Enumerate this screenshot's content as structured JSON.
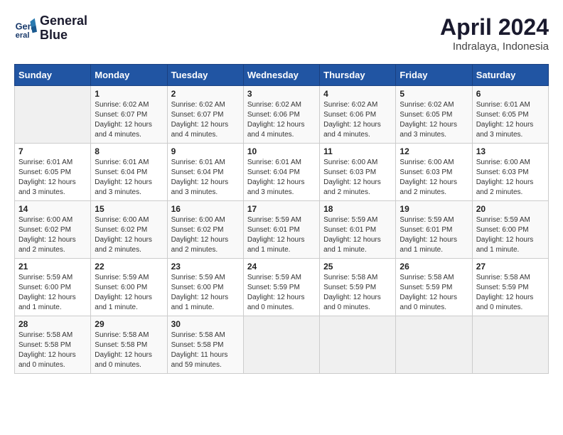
{
  "header": {
    "logo_line1": "General",
    "logo_line2": "Blue",
    "month": "April 2024",
    "location": "Indralaya, Indonesia"
  },
  "weekdays": [
    "Sunday",
    "Monday",
    "Tuesday",
    "Wednesday",
    "Thursday",
    "Friday",
    "Saturday"
  ],
  "weeks": [
    [
      {
        "day": "",
        "info": ""
      },
      {
        "day": "1",
        "info": "Sunrise: 6:02 AM\nSunset: 6:07 PM\nDaylight: 12 hours\nand 4 minutes."
      },
      {
        "day": "2",
        "info": "Sunrise: 6:02 AM\nSunset: 6:07 PM\nDaylight: 12 hours\nand 4 minutes."
      },
      {
        "day": "3",
        "info": "Sunrise: 6:02 AM\nSunset: 6:06 PM\nDaylight: 12 hours\nand 4 minutes."
      },
      {
        "day": "4",
        "info": "Sunrise: 6:02 AM\nSunset: 6:06 PM\nDaylight: 12 hours\nand 4 minutes."
      },
      {
        "day": "5",
        "info": "Sunrise: 6:02 AM\nSunset: 6:05 PM\nDaylight: 12 hours\nand 3 minutes."
      },
      {
        "day": "6",
        "info": "Sunrise: 6:01 AM\nSunset: 6:05 PM\nDaylight: 12 hours\nand 3 minutes."
      }
    ],
    [
      {
        "day": "7",
        "info": "Sunrise: 6:01 AM\nSunset: 6:05 PM\nDaylight: 12 hours\nand 3 minutes."
      },
      {
        "day": "8",
        "info": "Sunrise: 6:01 AM\nSunset: 6:04 PM\nDaylight: 12 hours\nand 3 minutes."
      },
      {
        "day": "9",
        "info": "Sunrise: 6:01 AM\nSunset: 6:04 PM\nDaylight: 12 hours\nand 3 minutes."
      },
      {
        "day": "10",
        "info": "Sunrise: 6:01 AM\nSunset: 6:04 PM\nDaylight: 12 hours\nand 3 minutes."
      },
      {
        "day": "11",
        "info": "Sunrise: 6:00 AM\nSunset: 6:03 PM\nDaylight: 12 hours\nand 2 minutes."
      },
      {
        "day": "12",
        "info": "Sunrise: 6:00 AM\nSunset: 6:03 PM\nDaylight: 12 hours\nand 2 minutes."
      },
      {
        "day": "13",
        "info": "Sunrise: 6:00 AM\nSunset: 6:03 PM\nDaylight: 12 hours\nand 2 minutes."
      }
    ],
    [
      {
        "day": "14",
        "info": "Sunrise: 6:00 AM\nSunset: 6:02 PM\nDaylight: 12 hours\nand 2 minutes."
      },
      {
        "day": "15",
        "info": "Sunrise: 6:00 AM\nSunset: 6:02 PM\nDaylight: 12 hours\nand 2 minutes."
      },
      {
        "day": "16",
        "info": "Sunrise: 6:00 AM\nSunset: 6:02 PM\nDaylight: 12 hours\nand 2 minutes."
      },
      {
        "day": "17",
        "info": "Sunrise: 5:59 AM\nSunset: 6:01 PM\nDaylight: 12 hours\nand 1 minute."
      },
      {
        "day": "18",
        "info": "Sunrise: 5:59 AM\nSunset: 6:01 PM\nDaylight: 12 hours\nand 1 minute."
      },
      {
        "day": "19",
        "info": "Sunrise: 5:59 AM\nSunset: 6:01 PM\nDaylight: 12 hours\nand 1 minute."
      },
      {
        "day": "20",
        "info": "Sunrise: 5:59 AM\nSunset: 6:00 PM\nDaylight: 12 hours\nand 1 minute."
      }
    ],
    [
      {
        "day": "21",
        "info": "Sunrise: 5:59 AM\nSunset: 6:00 PM\nDaylight: 12 hours\nand 1 minute."
      },
      {
        "day": "22",
        "info": "Sunrise: 5:59 AM\nSunset: 6:00 PM\nDaylight: 12 hours\nand 1 minute."
      },
      {
        "day": "23",
        "info": "Sunrise: 5:59 AM\nSunset: 6:00 PM\nDaylight: 12 hours\nand 1 minute."
      },
      {
        "day": "24",
        "info": "Sunrise: 5:59 AM\nSunset: 5:59 PM\nDaylight: 12 hours\nand 0 minutes."
      },
      {
        "day": "25",
        "info": "Sunrise: 5:58 AM\nSunset: 5:59 PM\nDaylight: 12 hours\nand 0 minutes."
      },
      {
        "day": "26",
        "info": "Sunrise: 5:58 AM\nSunset: 5:59 PM\nDaylight: 12 hours\nand 0 minutes."
      },
      {
        "day": "27",
        "info": "Sunrise: 5:58 AM\nSunset: 5:59 PM\nDaylight: 12 hours\nand 0 minutes."
      }
    ],
    [
      {
        "day": "28",
        "info": "Sunrise: 5:58 AM\nSunset: 5:58 PM\nDaylight: 12 hours\nand 0 minutes."
      },
      {
        "day": "29",
        "info": "Sunrise: 5:58 AM\nSunset: 5:58 PM\nDaylight: 12 hours\nand 0 minutes."
      },
      {
        "day": "30",
        "info": "Sunrise: 5:58 AM\nSunset: 5:58 PM\nDaylight: 11 hours\nand 59 minutes."
      },
      {
        "day": "",
        "info": ""
      },
      {
        "day": "",
        "info": ""
      },
      {
        "day": "",
        "info": ""
      },
      {
        "day": "",
        "info": ""
      }
    ]
  ]
}
